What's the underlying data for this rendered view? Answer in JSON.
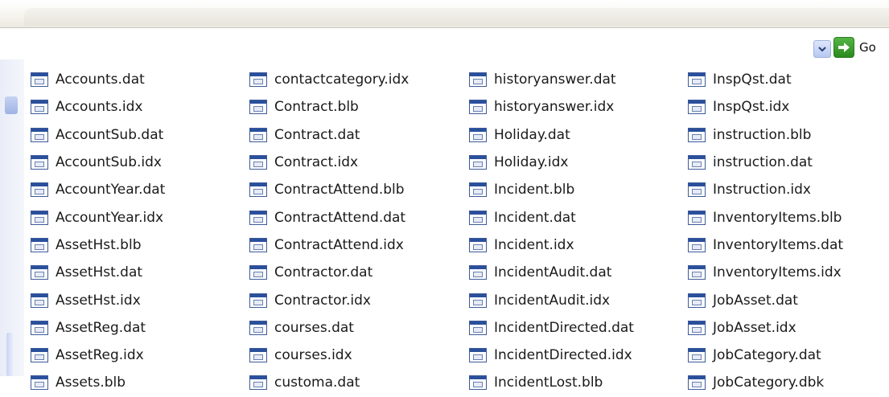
{
  "address": {
    "value": "",
    "go_label": "Go"
  },
  "icons": {
    "dropdown": "chevron-down-icon",
    "go": "go-arrow-icon",
    "file": "data-file-icon"
  },
  "columns": [
    [
      "Accounts.dat",
      "Accounts.idx",
      "AccountSub.dat",
      "AccountSub.idx",
      "AccountYear.dat",
      "AccountYear.idx",
      "AssetHst.blb",
      "AssetHst.dat",
      "AssetHst.idx",
      "AssetReg.dat",
      "AssetReg.idx",
      "Assets.blb"
    ],
    [
      "contactcategory.idx",
      "Contract.blb",
      "Contract.dat",
      "Contract.idx",
      "ContractAttend.blb",
      "ContractAttend.dat",
      "ContractAttend.idx",
      "Contractor.dat",
      "Contractor.idx",
      "courses.dat",
      "courses.idx",
      "customa.dat"
    ],
    [
      "historyanswer.dat",
      "historyanswer.idx",
      "Holiday.dat",
      "Holiday.idx",
      "Incident.blb",
      "Incident.dat",
      "Incident.idx",
      "IncidentAudit.dat",
      "IncidentAudit.idx",
      "IncidentDirected.dat",
      "IncidentDirected.idx",
      "IncidentLost.blb"
    ],
    [
      "InspQst.dat",
      "InspQst.idx",
      "instruction.blb",
      "instruction.dat",
      "Instruction.idx",
      "InventoryItems.blb",
      "InventoryItems.dat",
      "InventoryItems.idx",
      "JobAsset.dat",
      "JobAsset.idx",
      "JobCategory.dat",
      "JobCategory.dbk"
    ]
  ]
}
